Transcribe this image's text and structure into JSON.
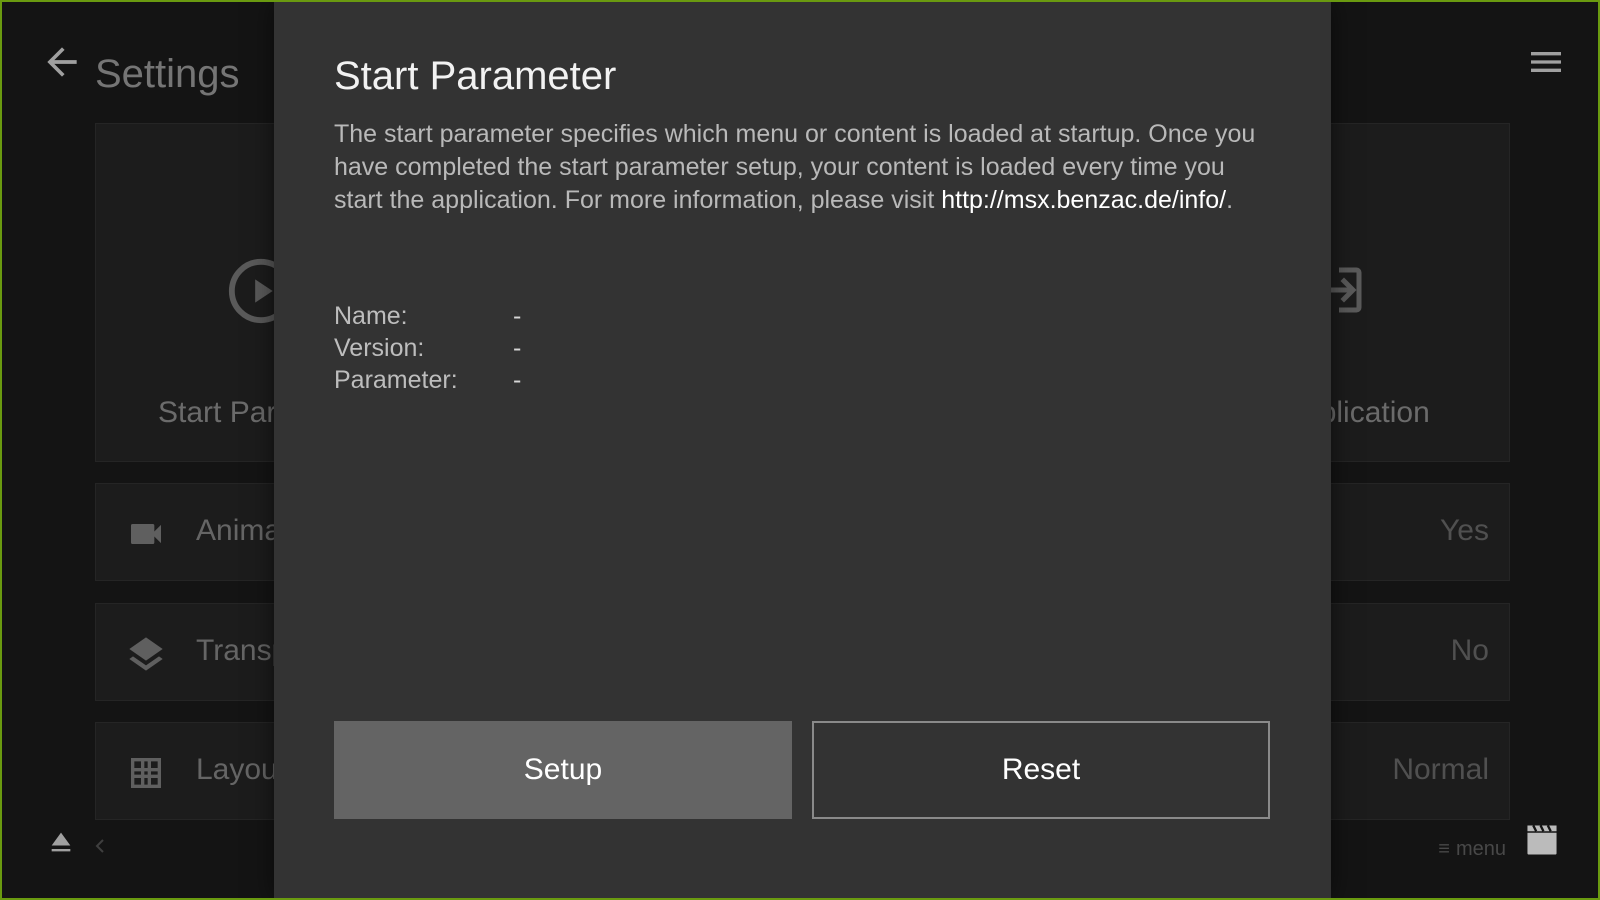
{
  "header": {
    "title": "Settings",
    "back_icon": "arrow-left-icon",
    "menu_icon": "hamburger-menu-icon"
  },
  "tiles": {
    "left": {
      "label": "Start Parameter",
      "icon": "play-circle-icon"
    },
    "right": {
      "label": "Application",
      "icon": "login-box-icon"
    }
  },
  "rows": [
    {
      "label": "Animations",
      "value": "Yes",
      "icon": "video-camera-icon"
    },
    {
      "label": "Transparency",
      "value": "No",
      "icon": "layers-icon"
    },
    {
      "label": "Layout",
      "value": "Normal",
      "icon": "grid-icon"
    }
  ],
  "footer": {
    "menu_hint": "menu",
    "eject_icon": "eject-icon",
    "prev_icon": "chevron-left-icon",
    "clapper_icon": "clapperboard-icon"
  },
  "dialog": {
    "title": "Start Parameter",
    "description": "The start parameter specifies which menu or content is loaded at startup. Once you have completed the start parameter setup, your content is loaded every time you start the application. For more information, please visit ",
    "link": "http://msx.benzac.de/info/",
    "description_end": ".",
    "info": [
      {
        "key": "Name:",
        "value": "-"
      },
      {
        "key": "Version:",
        "value": "-"
      },
      {
        "key": "Parameter:",
        "value": "-"
      }
    ],
    "setup_label": "Setup",
    "reset_label": "Reset"
  },
  "colors": {
    "frame": "#6a9a10",
    "dialog_bg": "#333333",
    "setup_bg": "#646464"
  }
}
